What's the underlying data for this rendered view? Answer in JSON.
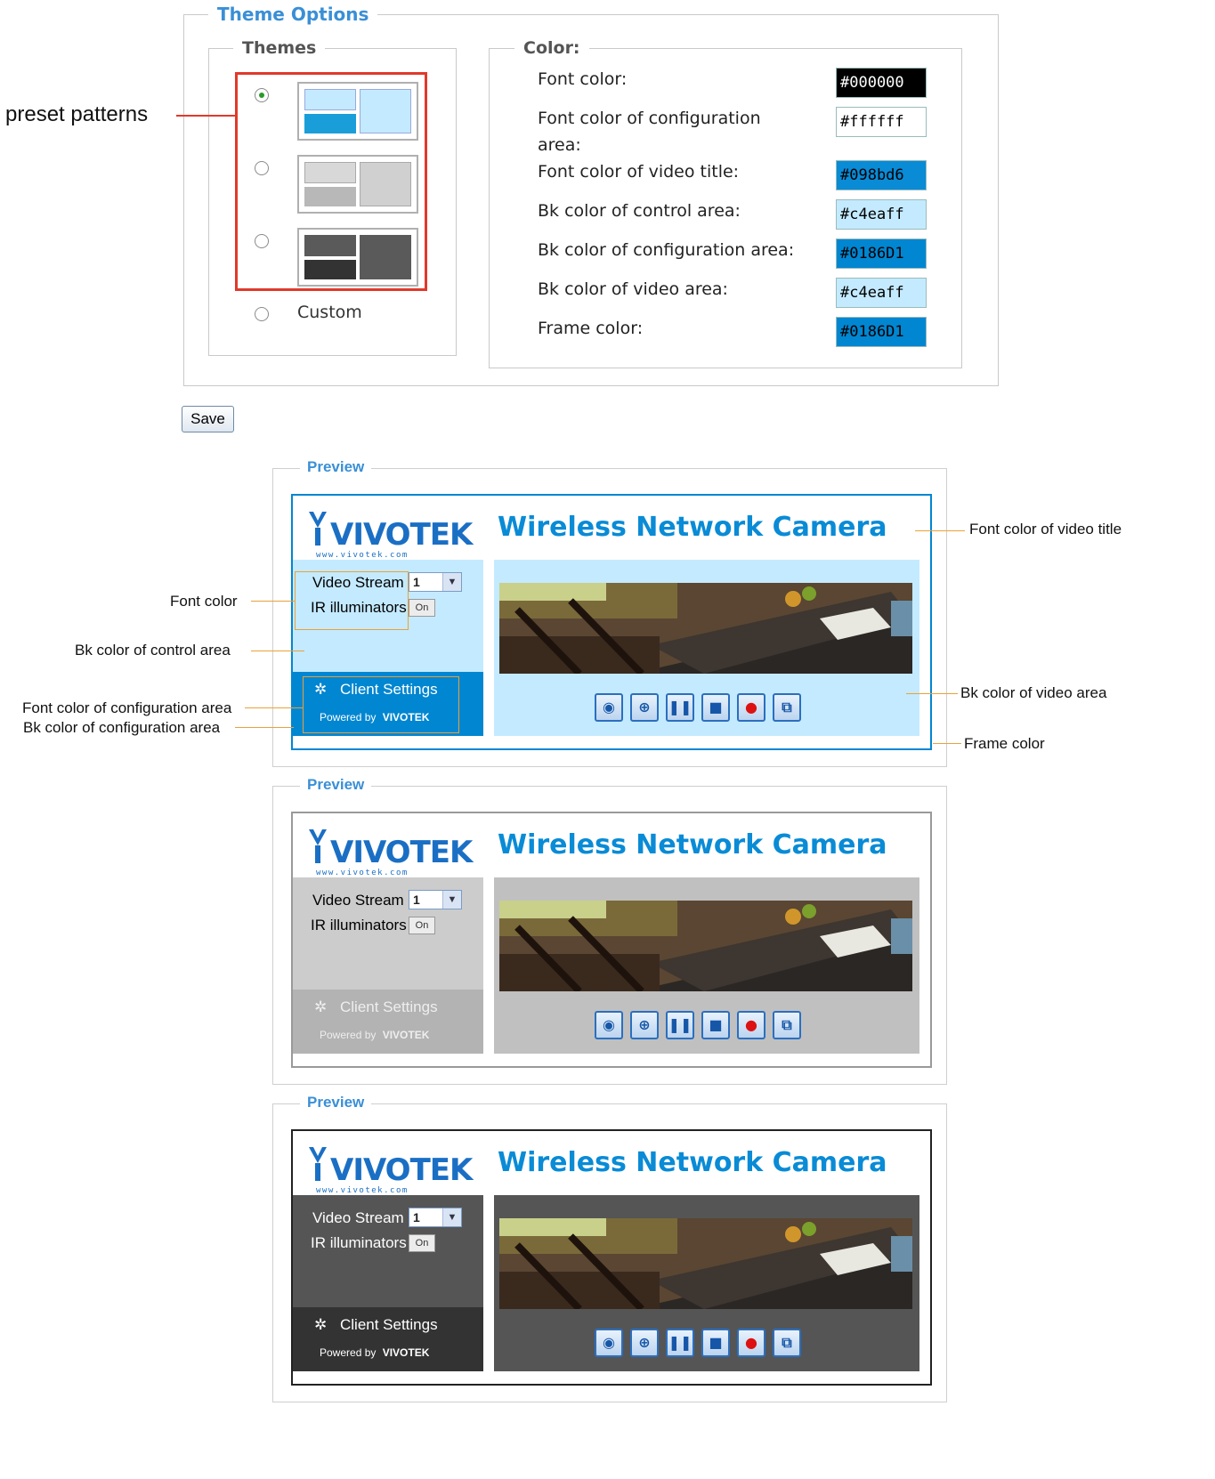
{
  "theme_options": {
    "title": "Theme Options",
    "themes_title": "Themes",
    "custom_label": "Custom",
    "color_title": "Color:",
    "color_rows": [
      {
        "label": "Font color:",
        "value": "#000000",
        "bg": "#000000",
        "fg": "#ffffff"
      },
      {
        "label": "Font color of configuration area:",
        "value": "#ffffff",
        "bg": "#ffffff",
        "fg": "#000000"
      },
      {
        "label": "Font color of video title:",
        "value": "#098bd6",
        "bg": "#098bd6",
        "fg": "#000000"
      },
      {
        "label": "Bk color of control area:",
        "value": "#c4eaff",
        "bg": "#c4eaff",
        "fg": "#000000"
      },
      {
        "label": "Bk color of configuration area:",
        "value": "#0186D1",
        "bg": "#0186D1",
        "fg": "#000000"
      },
      {
        "label": "Bk color of video area:",
        "value": "#c4eaff",
        "bg": "#c4eaff",
        "fg": "#000000"
      },
      {
        "label": "Frame color:",
        "value": "#0186D1",
        "bg": "#0186D1",
        "fg": "#000000"
      }
    ],
    "save_label": "Save"
  },
  "annotations": {
    "preset_patterns": "preset patterns",
    "font_color_video_title": "Font color of video title",
    "font_color": "Font color",
    "bk_control_area": "Bk color of control area",
    "bk_video_area": "Bk color of video area",
    "font_color_config_area": "Font color of configuration area",
    "bk_config_area": "Bk color of configuration area",
    "frame_color": "Frame color"
  },
  "preview": {
    "legend": "Preview",
    "brand": "VIVOTEK",
    "brand_url": "www.vivotek.com",
    "camera_title": "Wireless Network Camera",
    "video_stream_label": "Video Stream",
    "video_stream_value": "1",
    "ir_label": "IR illuminators",
    "ir_button": "On",
    "client_settings": "Client Settings",
    "powered_by": "Powered by",
    "powered_brand": "VIVOTEK"
  },
  "themes": [
    {
      "frame": "#0186D1",
      "title": "#098bd6",
      "ctrl": "#c4eaff",
      "conf": "#0186D1",
      "conf_font": "#ffffff",
      "video": "#c4eaff"
    },
    {
      "frame": "#999999",
      "title": "#098bd6",
      "ctrl": "#cccccc",
      "conf": "#b3b3b3",
      "conf_font": "#eeeeee",
      "video": "#c0c0c0"
    },
    {
      "frame": "#222222",
      "title": "#098bd6",
      "ctrl": "#555555",
      "conf": "#333333",
      "conf_font": "#ffffff",
      "video": "#555555"
    }
  ]
}
